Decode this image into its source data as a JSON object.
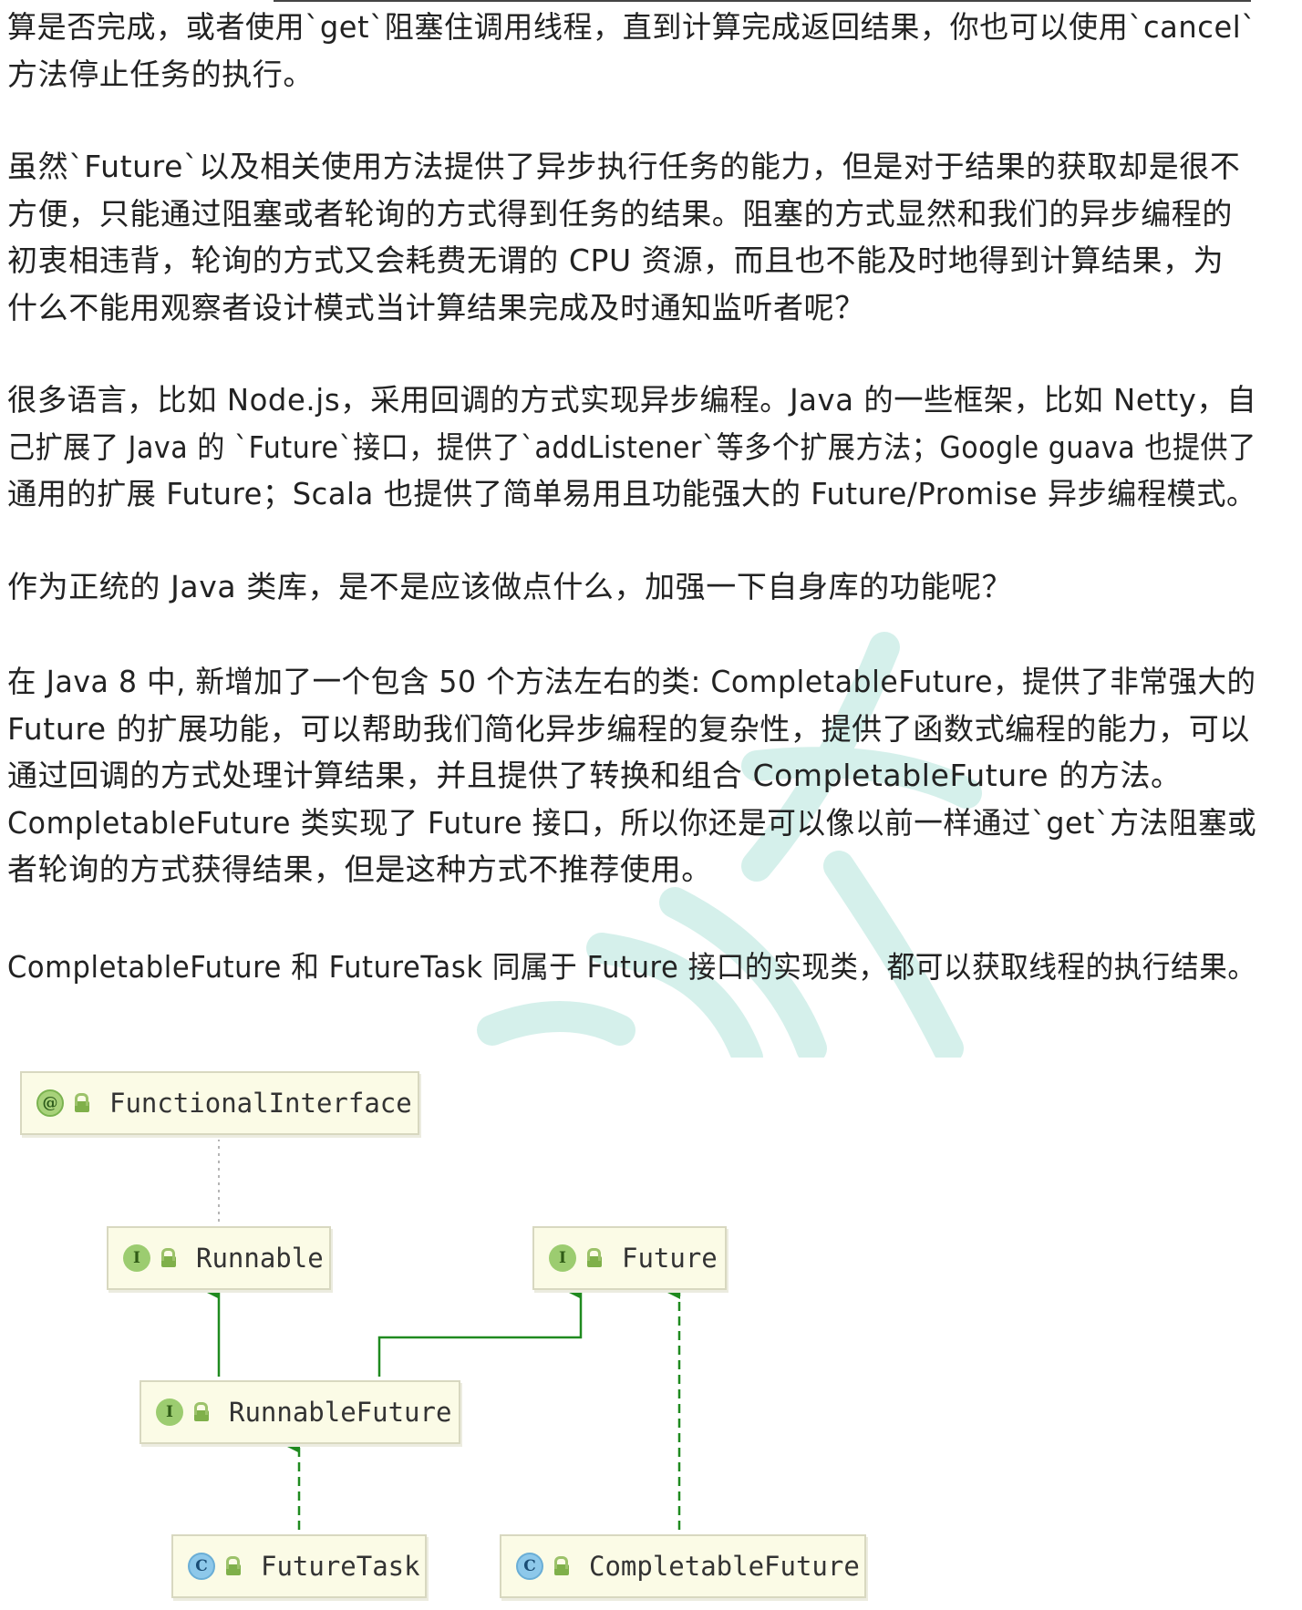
{
  "paragraphs": [
    {
      "lines": [
        "算是否完成，或者使用`get`阻塞住调用线程，直到计算完成返回结果，你也可以使用`cancel`",
        "方法停止任务的执行。"
      ]
    },
    {
      "lines": [
        "虽然`Future`以及相关使用方法提供了异步执行任务的能力，但是对于结果的获取却是很不",
        "方便，只能通过阻塞或者轮询的方式得到任务的结果。阻塞的方式显然和我们的异步编程的",
        "初衷相违背，轮询的方式又会耗费无谓的 CPU 资源，而且也不能及时地得到计算结果，为",
        "什么不能用观察者设计模式当计算结果完成及时通知监听者呢？"
      ]
    },
    {
      "lines": [
        "很多语言，比如 Node.js，采用回调的方式实现异步编程。Java 的一些框架，比如 Netty，自",
        "己扩展了 Java 的 `Future`接口，提供了`addListener`等多个扩展方法；Google guava 也提供了",
        "通用的扩展 Future；Scala 也提供了简单易用且功能强大的 Future/Promise 异步编程模式。"
      ]
    },
    {
      "lines": [
        "作为正统的 Java 类库，是不是应该做点什么，加强一下自身库的功能呢？"
      ]
    },
    {
      "lines": [
        "在 Java 8 中, 新增加了一个包含 50 个方法左右的类: CompletableFuture，提供了非常强大的",
        "Future 的扩展功能，可以帮助我们简化异步编程的复杂性，提供了函数式编程的能力，可以",
        "通过回调的方式处理计算结果，并且提供了转换和组合 CompletableFuture 的方法。",
        "CompletableFuture 类实现了 Future 接口，所以你还是可以像以前一样通过`get`方法阻塞或",
        "者轮询的方式获得结果，但是这种方式不推荐使用。"
      ]
    },
    {
      "lines": [
        "CompletableFuture 和 FutureTask 同属于 Future 接口的实现类，都可以获取线程的执行结果。"
      ]
    }
  ],
  "diagram": {
    "nodes": [
      {
        "id": "functional_interface",
        "badge": "@",
        "kind": "annotation",
        "label": "FunctionalInterface"
      },
      {
        "id": "runnable",
        "badge": "I",
        "kind": "interface",
        "label": "Runnable"
      },
      {
        "id": "future",
        "badge": "I",
        "kind": "interface",
        "label": "Future"
      },
      {
        "id": "runnable_future",
        "badge": "I",
        "kind": "interface",
        "label": "RunnableFuture"
      },
      {
        "id": "future_task",
        "badge": "C",
        "kind": "class",
        "label": "FutureTask"
      },
      {
        "id": "completable_future",
        "badge": "C",
        "kind": "class",
        "label": "CompletableFuture"
      }
    ],
    "edges": [
      {
        "from": "runnable",
        "to": "functional_interface",
        "style": "dotted"
      },
      {
        "from": "runnable_future",
        "to": "runnable",
        "style": "solid-extends"
      },
      {
        "from": "runnable_future",
        "to": "future",
        "style": "solid-extends"
      },
      {
        "from": "future_task",
        "to": "runnable_future",
        "style": "dashed-implements"
      },
      {
        "from": "completable_future",
        "to": "future",
        "style": "dashed-implements"
      }
    ],
    "colors": {
      "arrow": "#1f8a1f",
      "dotted": "#aaaaaa",
      "box_fill": "#fbfbe6",
      "box_border": "#d8d8c0"
    }
  }
}
